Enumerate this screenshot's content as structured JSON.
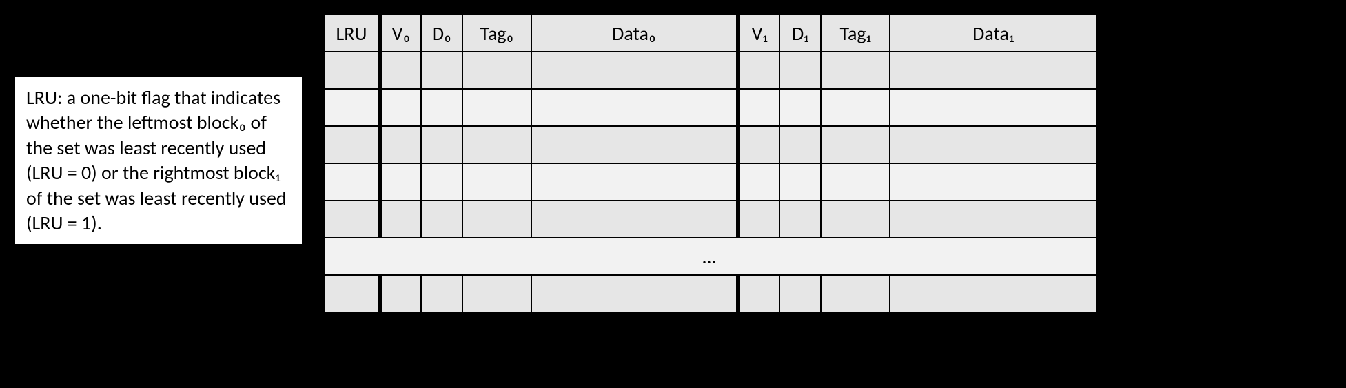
{
  "description": "LRU: a one-bit flag that indicates whether the leftmost block₀ of the set was least recently used (LRU = 0) or the rightmost block₁ of the set was least recently used (LRU = 1).",
  "headers": {
    "lru": "LRU",
    "v0": "V₀",
    "d0": "D₀",
    "tag0": "Tag₀",
    "data0": "Data₀",
    "v1": "V₁",
    "d1": "D₁",
    "tag1": "Tag₁",
    "data1": "Data₁"
  },
  "ellipsis": "…"
}
